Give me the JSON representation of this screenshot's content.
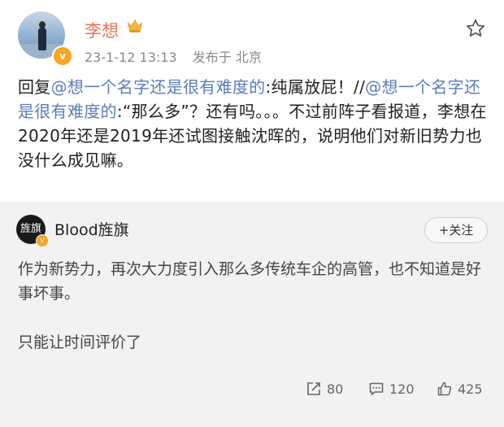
{
  "post": {
    "author": "李想",
    "date": "23-1-12 13:13",
    "location": "发布于 北京",
    "content": {
      "reply_prefix": "回复",
      "mention1": "@想一个名字还是很有难度的",
      "part1": ":纯属放屁！//",
      "mention2": "@想一个名字还是很有难度的",
      "part2": ":“那么多”？还有吗。。。不过前阵子看报道，李想在2020年还是2019年还试图接触沈晖的，说明他们对新旧势力也没什么成见嘛。"
    }
  },
  "quoted": {
    "author": "Blood旌旗",
    "avatar_text": "旌旗",
    "follow_label": "+关注",
    "paragraph1": "作为新势力，再次大力度引入那么多传统车企的高管，也不知道是好事坏事。",
    "paragraph2": "只能让时间评价了",
    "stats": {
      "reposts": "80",
      "comments": "120",
      "likes": "425"
    }
  },
  "colors": {
    "username": "#eb7350",
    "link": "#5b7db8",
    "badge": "#f5a623",
    "quoted_bg": "#f2f2f2"
  }
}
